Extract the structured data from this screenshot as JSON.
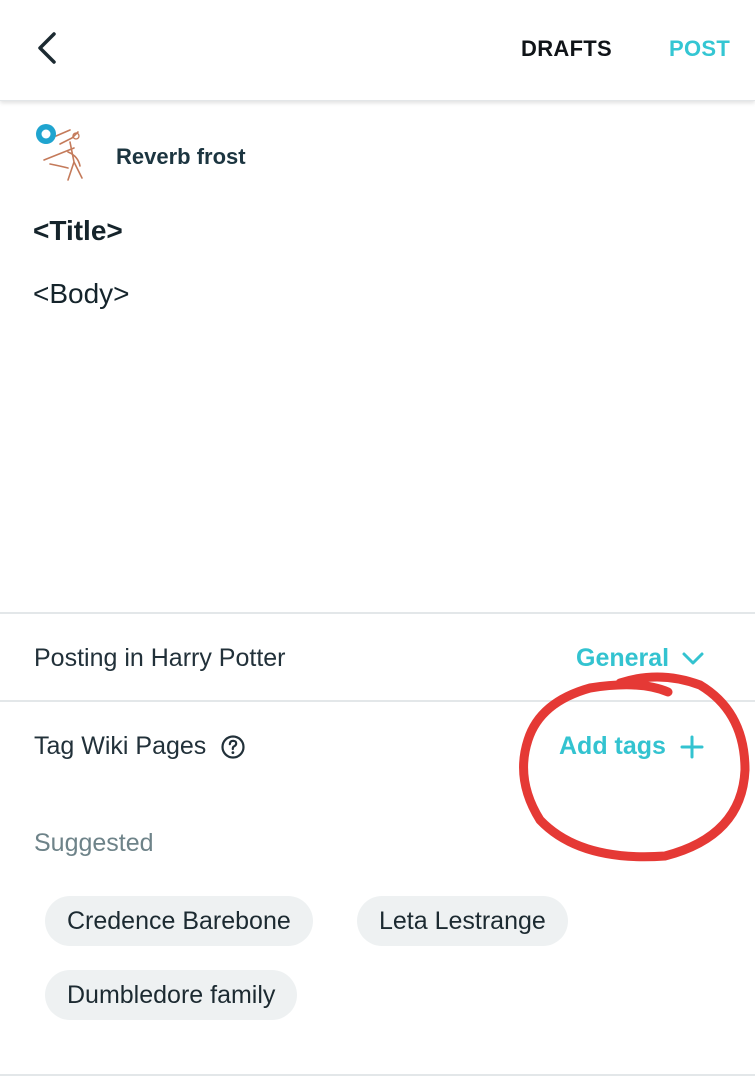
{
  "header": {
    "back_icon": "chevron-left-icon",
    "drafts_label": "DRAFTS",
    "post_label": "POST"
  },
  "author": {
    "name": "Reverb frost",
    "avatar_icon": "avatar-sketch"
  },
  "editor": {
    "title_text": "<Title>",
    "body_text": "<Body>"
  },
  "posting": {
    "label": "Posting in Harry Potter",
    "category": "General",
    "category_icon": "chevron-down-icon"
  },
  "tags": {
    "label": "Tag Wiki Pages",
    "help_icon": "help-circle-icon",
    "add_label": "Add tags",
    "add_icon": "plus-icon"
  },
  "suggested": {
    "label": "Suggested",
    "chips": [
      "Credence Barebone",
      "Leta Lestrange",
      "Dumbledore family"
    ]
  },
  "colors": {
    "accent": "#34c6d3",
    "annotation": "#e53935",
    "chip_bg": "#eef1f2"
  }
}
